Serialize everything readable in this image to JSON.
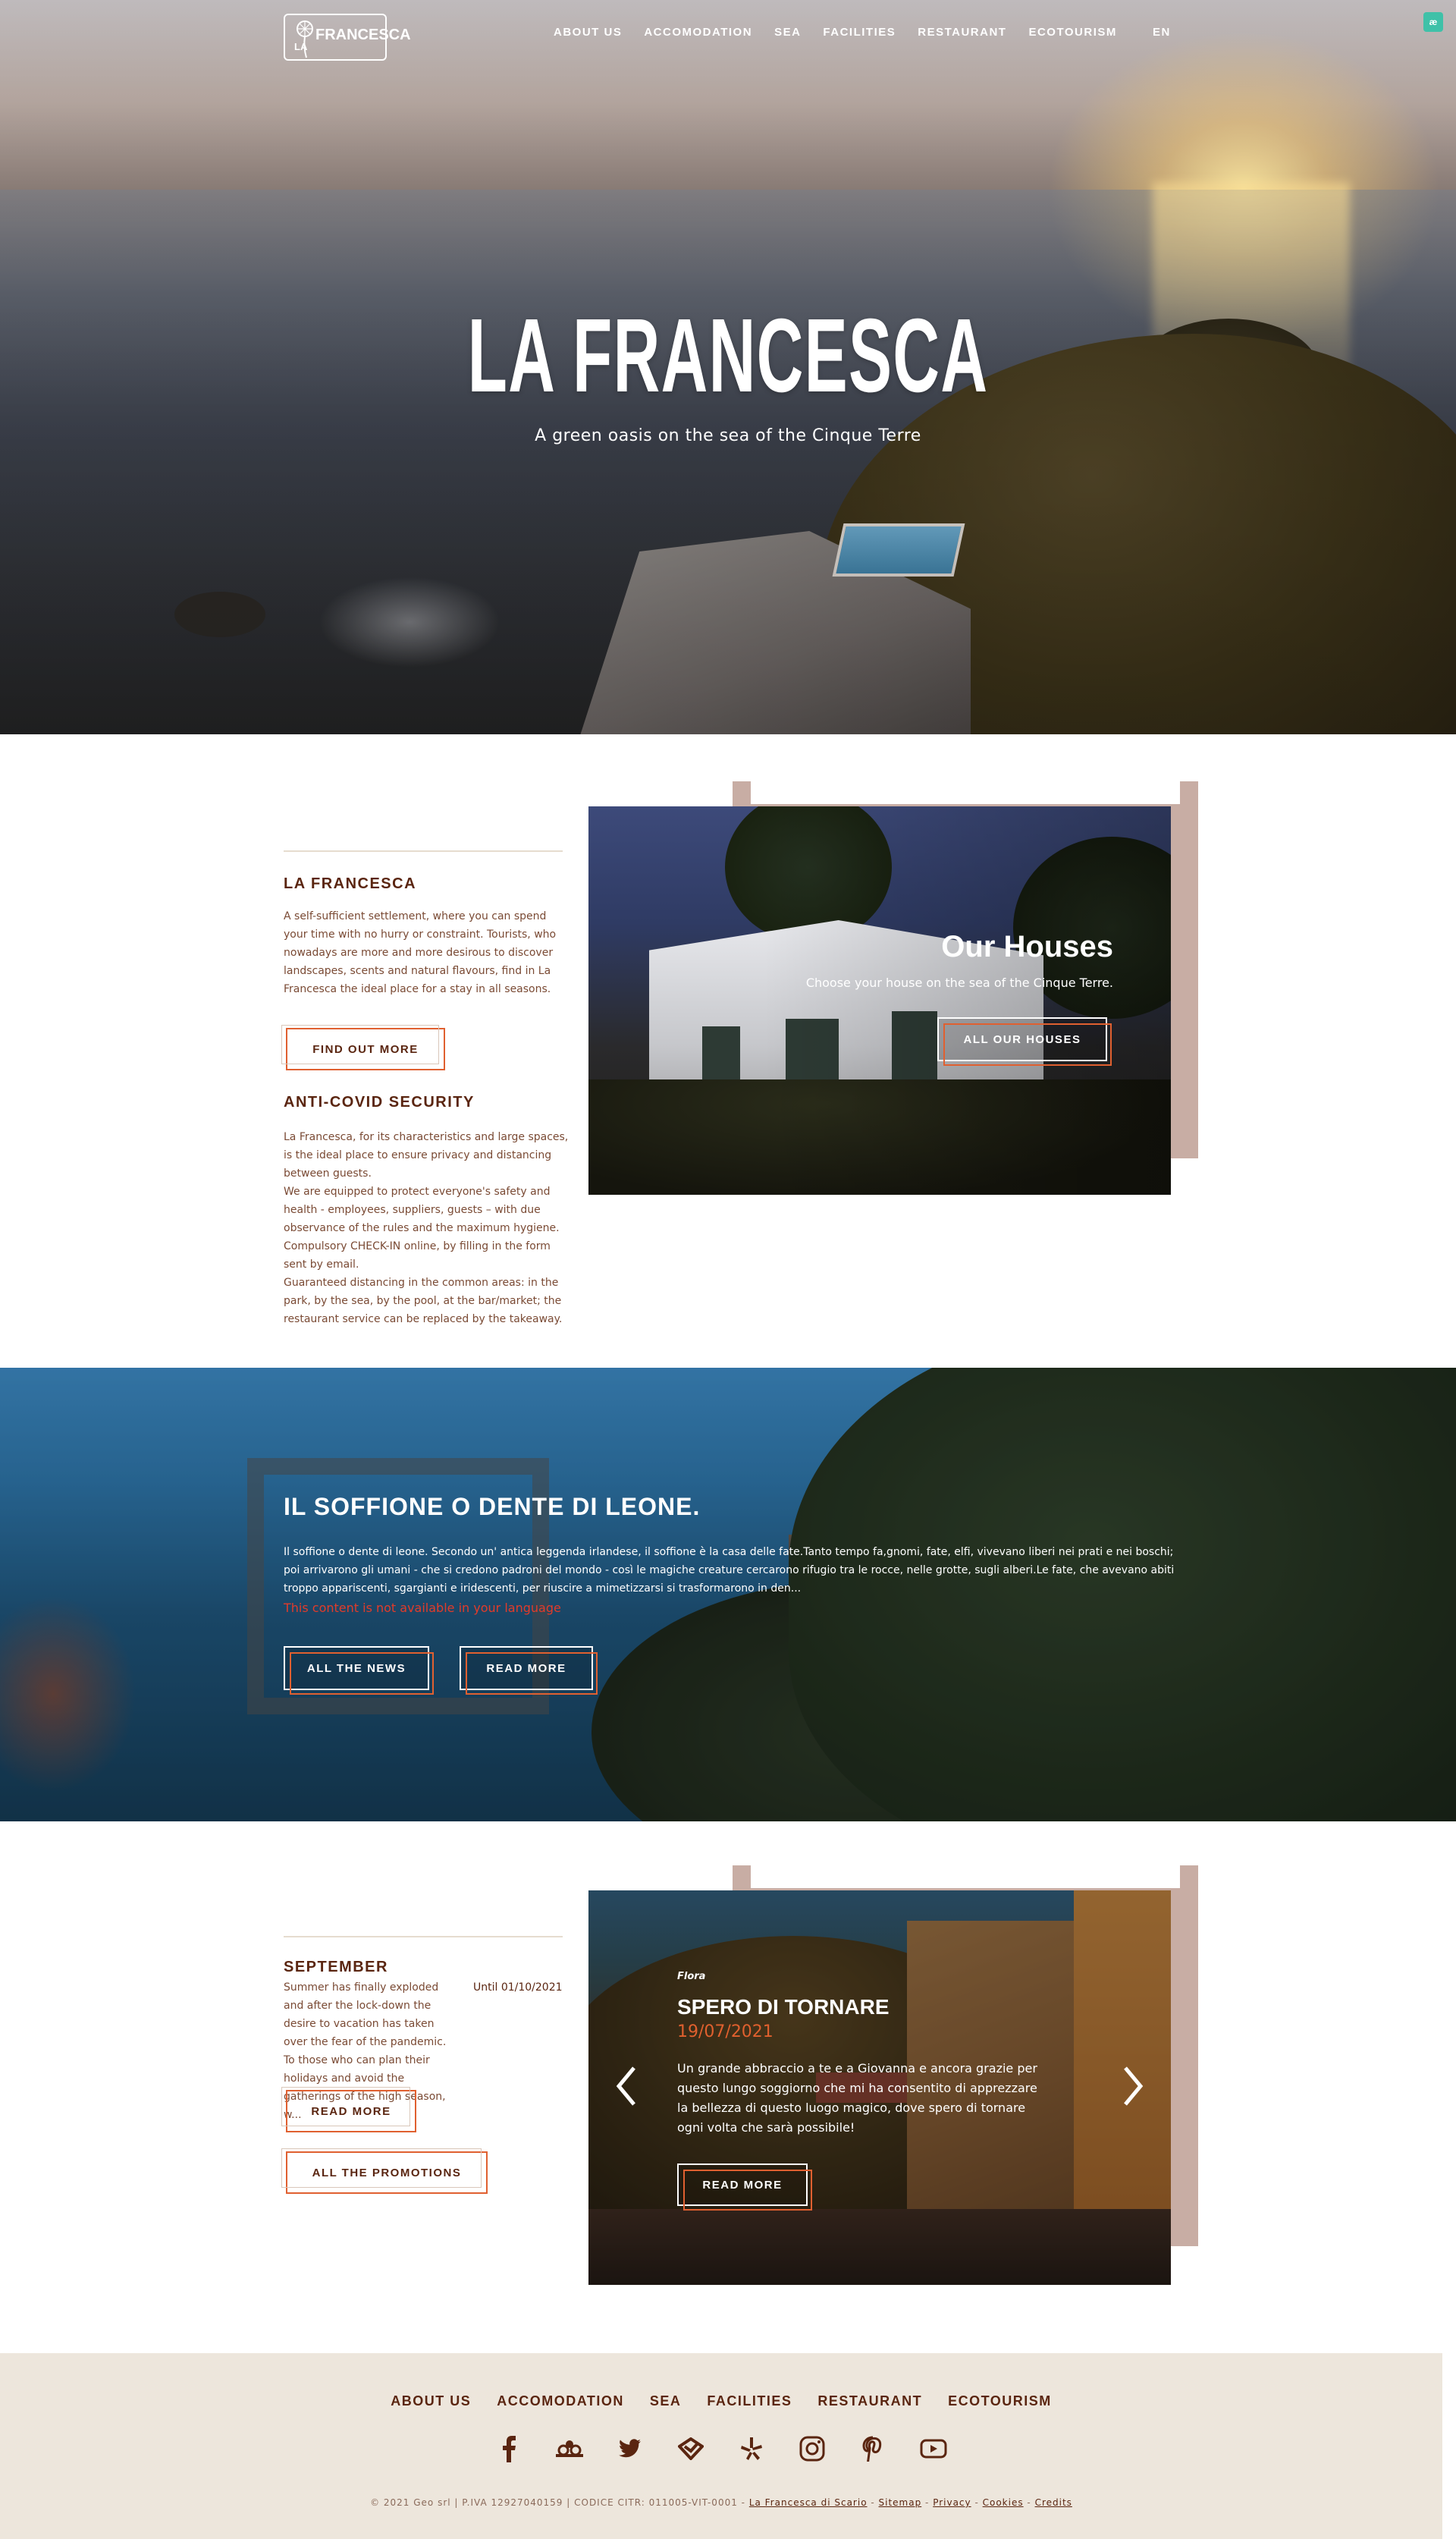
{
  "header": {
    "logo_word": "FRANCESCA",
    "logo_prefix": "LA",
    "nav": [
      "ABOUT US",
      "ACCOMODATION",
      "SEA",
      "FACILITIES",
      "RESTAURANT",
      "ECOTOURISM"
    ],
    "language": "EN",
    "accessibility_badge": "æ"
  },
  "hero": {
    "title": "LA FRANCESCA",
    "subtitle": "A green oasis on the sea of the Cinque Terre"
  },
  "intro": {
    "about_heading": "LA FRANCESCA",
    "about_text": "A self-sufficient settlement, where you can spend your time with no hurry or constraint. Tourists, who nowadays are more and more desirous to discover landscapes, scents and natural flavours, find in La Francesca the ideal place for a stay in all seasons.",
    "about_button": "FIND OUT MORE",
    "covid_heading": "ANTI-COVID SECURITY",
    "covid_text": "La Francesca, for its characteristics and large spaces, is the ideal place to ensure privacy and distancing between guests.\nWe are equipped to protect everyone's safety and health - employees, suppliers, guests – with due observance of the rules and the maximum hygiene.\nCompulsory CHECK-IN online, by filling in the form sent by email.\nGuaranteed distancing in the common areas: in the park, by the sea, by the pool, at the bar/market; the restaurant service can be replaced by the takeaway.",
    "houses_title": "Our Houses",
    "houses_sub": "Choose your house on the sea of the Cinque Terre.",
    "houses_button": "ALL OUR HOUSES"
  },
  "news": {
    "title": "IL SOFFIONE O DENTE DI LEONE.",
    "text": "Il soffione o dente di leone. Secondo un' antica leggenda irlandese, il soffione è la casa delle fate.Tanto tempo fa,gnomi, fate, elfi, vivevano liberi nei prati e nei boschi; poi arrivarono gli umani - che si credono padroni del mondo - così le magiche creature cercarono rifugio tra le rocce, nelle grotte, sugli alberi.Le fate, che avevano abiti troppo appariscenti, sgargianti e iridescenti, per riuscire a mimetizzarsi si trasformarono in den...",
    "warning": "This content is not available in your language",
    "all_button": "ALL THE NEWS",
    "read_button": "READ MORE"
  },
  "promo": {
    "heading": "SEPTEMBER",
    "until": "Until 01/10/2021",
    "text": "Summer has finally exploded and after the lock-down the desire to vacation has taken over the fear of the pandemic. To those who can plan their holidays and avoid the gatherings of the high season, w...",
    "read_button": "READ MORE",
    "all_button": "ALL THE PROMOTIONS"
  },
  "review": {
    "author": "Flora",
    "title": "SPERO DI TORNARE",
    "date": "19/07/2021",
    "text": "Un grande abbraccio a te e a Giovanna e ancora grazie per questo lungo soggiorno che mi ha consentito di apprezzare la bellezza di questo luogo magico, dove spero di tornare ogni volta che sarà possibile!",
    "button": "READ MORE"
  },
  "footer": {
    "nav": [
      "ABOUT US",
      "ACCOMODATION",
      "SEA",
      "FACILITIES",
      "RESTAURANT",
      "ECOTOURISM"
    ],
    "socials": [
      "facebook-icon",
      "tripadvisor-icon",
      "twitter-icon",
      "foursquare-icon",
      "yelp-icon",
      "instagram-icon",
      "pinterest-icon",
      "youtube-icon"
    ],
    "legal_prefix": "© 2021 Geo srl | P.IVA 12927040159 | CODICE CITR: 011005-VIT-0001 -",
    "links": [
      "La Francesca di Scario",
      "Sitemap",
      "Privacy",
      "Cookies",
      "Credits"
    ]
  },
  "colors": {
    "brand_brown": "#5a2510",
    "accent_orange": "#e06030",
    "frame_rose": "#c8ada4",
    "footer_bg": "#ede6dc"
  }
}
